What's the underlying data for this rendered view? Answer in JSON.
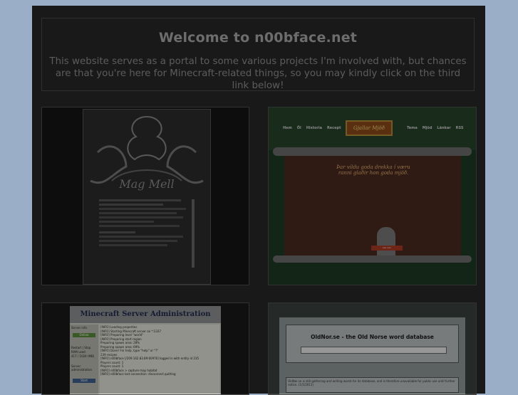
{
  "welcome": {
    "title": "Welcome to n00bface.net",
    "description": "This website serves as a portal to some various projects I'm involved with, but chances are that you're here for Minecraft-related things, so you may kindly click on the third link below!"
  },
  "tiles": {
    "mag_mell": {
      "logo_text": "Mag Mell"
    },
    "gjallar": {
      "logo_text": "Gjallar Mjöð",
      "nav_left": [
        "Hem",
        "Öl",
        "Historia",
        "Recept"
      ],
      "nav_right": [
        "Tema",
        "Mjöd",
        "Länkar",
        "RSS"
      ],
      "headline": "Þar vildu goda drekka í væru ranni glaðir hon goda mjöð.",
      "button_label": "Läs mer"
    },
    "minecraft": {
      "title": "Minecraft Server Administration",
      "sidebar": [
        "Server info",
        "Online",
        "Restart",
        "Stop",
        "RAM used",
        "417 / 1024 (MB)",
        "Server administration",
        "Start"
      ],
      "log_lines": [
        "[INFO] Loading properties",
        "[INFO] Starting Minecraft server on *:1337",
        "[INFO] Preparing level \"world\"",
        "[INFO] Preparing start region",
        "Preparing spawn area: 28%",
        "Preparing spawn area: 69%",
        "[INFO] Done! For help, type \"help\" or \"?\"",
        "239 recipes",
        "[INFO] n00bface [/209.162.83.89:60976] logged in with entity id 235",
        "Players count: 1",
        "Players count: 1",
        "[INFO] n00bface > capture map habitat",
        "[INFO] n00bface lost connection: disconnect.quitting"
      ]
    },
    "oldnor": {
      "title": "OldNor.se - the Old Norse word database",
      "footer_text": "OldNor.se is still gathering and writing words for its database, and is therefore unavailable for public use until further notice. (1/1/2011)"
    }
  }
}
